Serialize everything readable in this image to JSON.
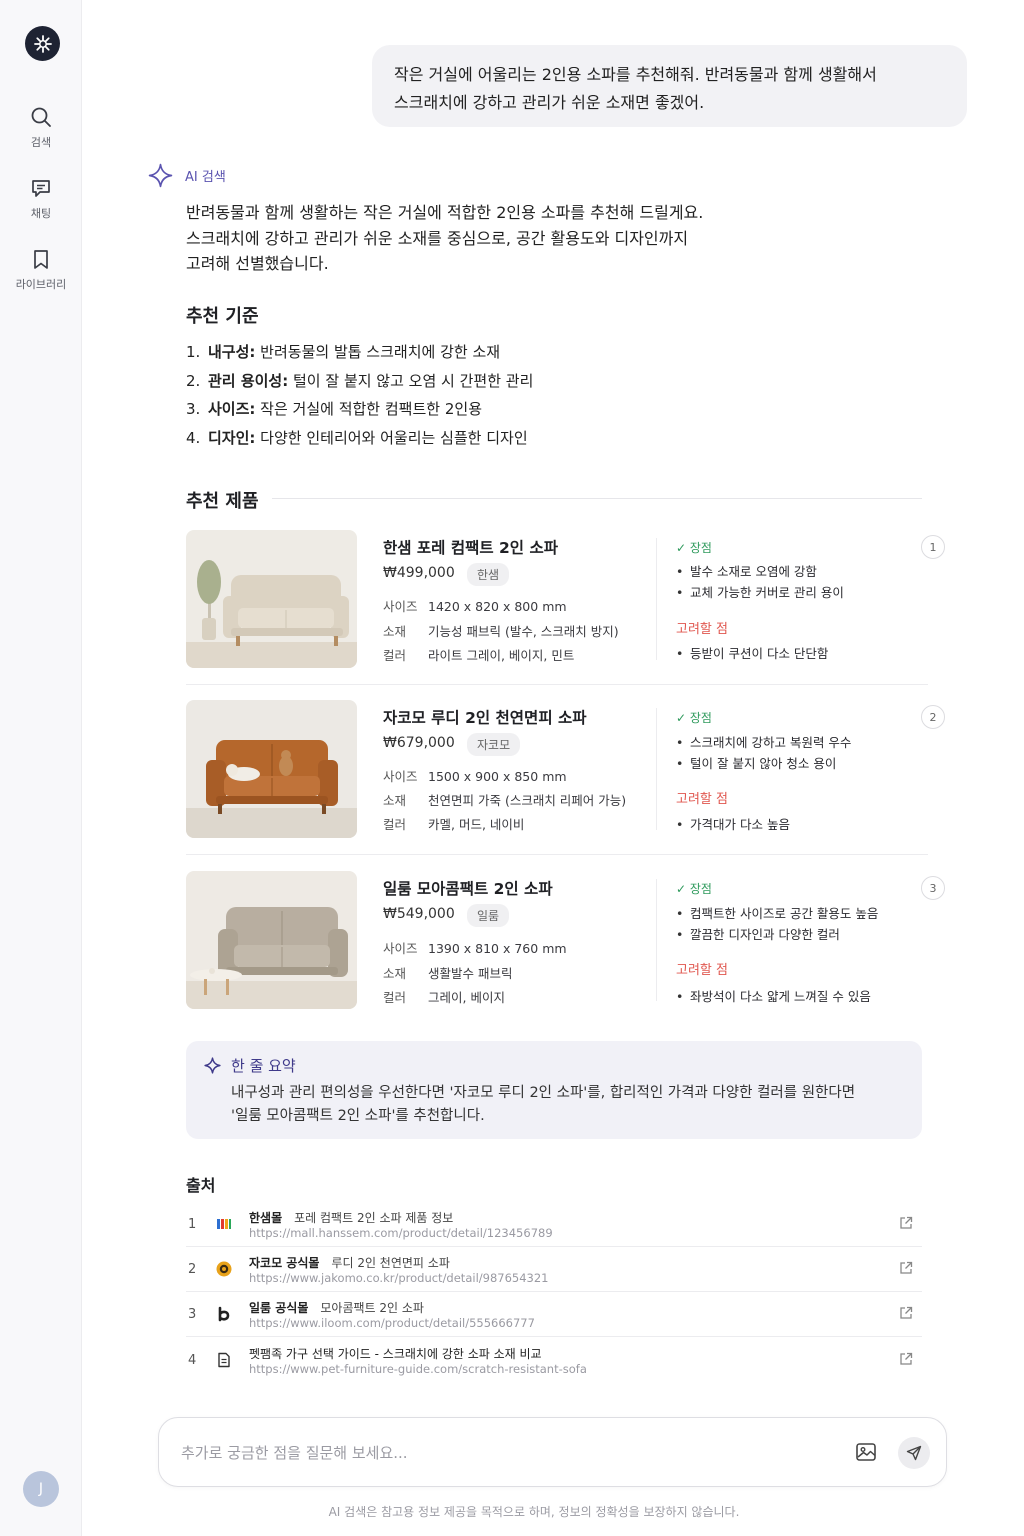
{
  "sidebar": {
    "items": [
      {
        "label": "검색",
        "icon": "search-icon"
      },
      {
        "label": "채팅",
        "icon": "chat-icon"
      },
      {
        "label": "라이브러리",
        "icon": "bookmark-icon"
      }
    ],
    "avatar": "J"
  },
  "user_message": {
    "line1": "작은 거실에 어울리는 2인용 소파를 추천해줘. 반려동물과 함께 생활해서",
    "line2": "스크래치에 강하고 관리가 쉬운 소재면 좋겠어."
  },
  "ai": {
    "label": "AI 검색",
    "intro_lines": [
      "반려동물과 함께 생활하는 작은 거실에 적합한 2인용 소파를 추천해 드릴게요.",
      "스크래치에 강하고 관리가 쉬운 소재를 중심으로, 공간 활용도와 디자인까지",
      "고려해 선별했습니다."
    ]
  },
  "criteria": {
    "title": "추천 기준",
    "items": [
      {
        "num": "1.",
        "key": "내구성:",
        "text": " 반려동물의 발톱 스크래치에 강한 소재"
      },
      {
        "num": "2.",
        "key": "관리 용이성:",
        "text": " 털이 잘 붙지 않고 오염 시 간편한 관리"
      },
      {
        "num": "3.",
        "key": "사이즈:",
        "text": " 작은 거실에 적합한 컴팩트한 2인용"
      },
      {
        "num": "4.",
        "key": "디자인:",
        "text": " 다양한 인테리어와 어울리는 심플한 디자인"
      }
    ]
  },
  "products_title": "추천 제품",
  "product_labels": {
    "size": "사이즈",
    "material": "소재",
    "color": "컬러",
    "pros": "✓ 장점",
    "cons": "고려할 점"
  },
  "products": [
    {
      "name": "한샘 포레 컴팩트 2인 소파",
      "price": "₩499,000",
      "brand": "한샘",
      "size": "1420 x 820 x 800 mm",
      "material": "기능성 패브릭 (발수, 스크래치 방지)",
      "color": "라이트 그레이, 베이지, 민트",
      "pros": [
        "발수 소재로 오염에 강함",
        "교체 가능한 커버로 관리 용이"
      ],
      "cons": [
        "등받이 쿠션이 다소 단단함"
      ],
      "rank": "1",
      "sofa_color": "#dcd3c3"
    },
    {
      "name": "자코모 루디 2인 천연면피 소파",
      "price": "₩679,000",
      "brand": "자코모",
      "size": "1500 x 900 x 850 mm",
      "material": "천연면피 가죽 (스크래치 리페어 가능)",
      "color": "카멜, 머드, 네이비",
      "pros": [
        "스크래치에 강하고 복원력 우수",
        "털이 잘 붙지 않아 청소 용이"
      ],
      "cons": [
        "가격대가 다소 높음"
      ],
      "rank": "2",
      "sofa_color": "#b5672c"
    },
    {
      "name": "일룸 모아콤팩트 2인 소파",
      "price": "₩549,000",
      "brand": "일룸",
      "size": "1390 x 810 x 760 mm",
      "material": "생활발수 패브릭",
      "color": "그레이, 베이지",
      "pros": [
        "컴팩트한 사이즈로 공간 활용도 높음",
        "깔끔한 디자인과 다양한 컬러"
      ],
      "cons": [
        "좌방석이 다소 얇게 느껴질 수 있음"
      ],
      "rank": "3",
      "sofa_color": "#b8aea0"
    }
  ],
  "summary": {
    "title": "한 줄 요약",
    "line1": "내구성과 관리 편의성을 우선한다면 '자코모 루디 2인 소파'를, 합리적인 가격과 다양한 컬러를 원한다면",
    "line2": "'일룸 모아콤팩트 2인 소파'를 추천합니다."
  },
  "sources": {
    "title": "출처",
    "items": [
      {
        "num": "1",
        "site": "한샘몰",
        "title": "포레 컴팩트 2인 소파 제품 정보",
        "url": "https://mall.hanssem.com/product/detail/123456789",
        "icon": "hanssem-logo-icon"
      },
      {
        "num": "2",
        "site": "자코모 공식몰",
        "title": "루디 2인 천연면피 소파",
        "url": "https://www.jakomo.co.kr/product/detail/987654321",
        "icon": "jakomo-logo-icon"
      },
      {
        "num": "3",
        "site": "일룸 공식몰",
        "title": "모아콤팩트 2인 소파",
        "url": "https://www.iloom.com/product/detail/555666777",
        "icon": "iloom-logo-icon"
      },
      {
        "num": "4",
        "site": "펫팸족 가구 선택 가이드 - 스크래치에 강한 소파 소재 비교",
        "title": "",
        "url": "https://www.pet-furniture-guide.com/scratch-resistant-sofa",
        "icon": "document-icon"
      }
    ]
  },
  "input": {
    "placeholder": "추가로 궁금한 점을 질문해 보세요..."
  },
  "disclaimer": "AI 검색은 참고용 정보 제공을 목적으로 하며, 정보의 정확성을 보장하지 않습니다.",
  "colors": {
    "accent": "#5b54b0",
    "pros": "#2e9a5c",
    "cons": "#e0574f"
  }
}
